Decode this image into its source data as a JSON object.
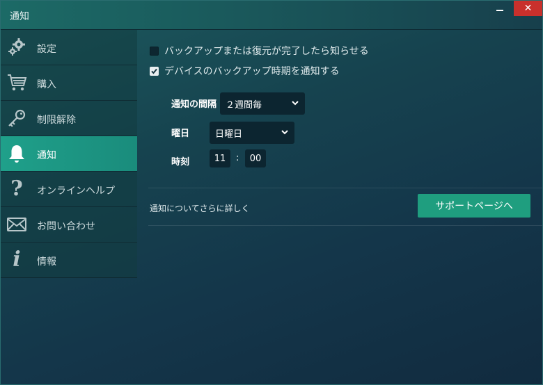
{
  "window": {
    "title": "通知"
  },
  "sidebar": {
    "items": [
      {
        "label": "設定",
        "icon": "gears-icon"
      },
      {
        "label": "購入",
        "icon": "cart-icon"
      },
      {
        "label": "制限解除",
        "icon": "key-icon"
      },
      {
        "label": "通知",
        "icon": "bell-icon",
        "active": true
      },
      {
        "label": "オンラインヘルプ",
        "icon": "question-icon"
      },
      {
        "label": "お問い合わせ",
        "icon": "envelope-icon"
      },
      {
        "label": "情報",
        "icon": "info-icon"
      }
    ]
  },
  "main": {
    "checkbox_backup_done": {
      "label": "バックアップまたは復元が完了したら知らせる",
      "checked": false
    },
    "checkbox_backup_time": {
      "label": "デバイスのバックアップ時期を通知する",
      "checked": true
    },
    "interval": {
      "label": "通知の間隔",
      "value": "２週間毎"
    },
    "weekday": {
      "label": "曜日",
      "value": "日曜日"
    },
    "time": {
      "label": "時刻",
      "hour": "11",
      "separator": ":",
      "minute": "00"
    },
    "learn_more": "通知についてさらに詳しく",
    "support_button": "サポートページへ"
  },
  "colors": {
    "accent": "#1f9e7f",
    "active_sidebar": "#1fa08a",
    "close_button": "#c9302c"
  }
}
